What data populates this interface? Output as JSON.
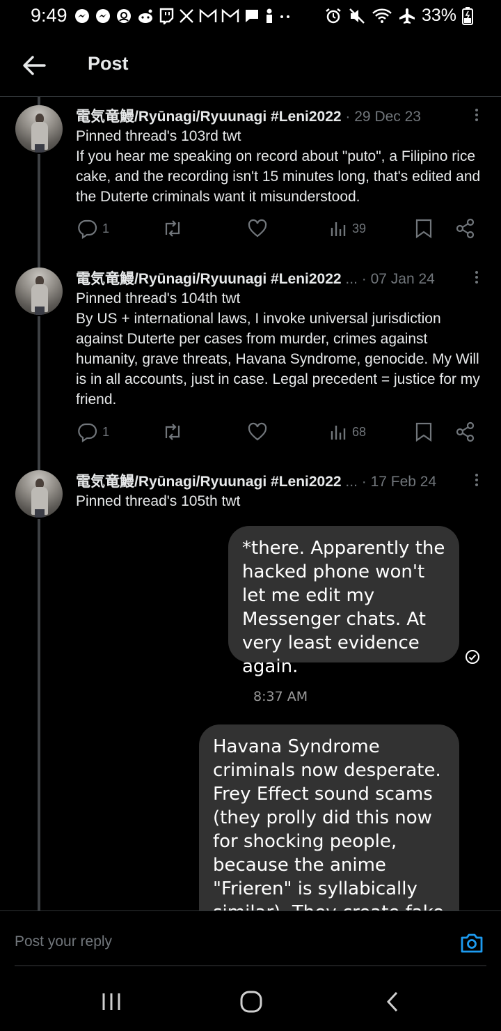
{
  "status_bar": {
    "time": "9:49",
    "battery": "33%",
    "icons_left": [
      "messenger-icon",
      "messenger-icon",
      "threads-icon",
      "reddit-icon",
      "twitch-icon",
      "x-icon",
      "gmail-icon",
      "gmail-icon",
      "chat-icon",
      "notification-icon",
      "more-dots-icon"
    ],
    "icons_right": [
      "alarm-icon",
      "mute-icon",
      "wifi-icon",
      "airplane-icon",
      "battery-icon"
    ]
  },
  "header": {
    "title": "Post"
  },
  "tweets": [
    {
      "author": "電気竜鰻/Ryūnagi/Ryuunagi #Leni2022",
      "meta": " · 29 Dec 23",
      "pinned": "Pinned thread's 103rd twt",
      "text": "If you hear me speaking on record about \"puto\", a Filipino rice cake, and the recording isn't 15 minutes long, that's edited and the Duterte criminals want it misunderstood.",
      "replies": "1",
      "views": "39"
    },
    {
      "author": "電気竜鰻/Ryūnagi/Ryuunagi #Leni2022",
      "meta": " ... · 07 Jan 24",
      "pinned": "Pinned thread's 104th twt",
      "text": "By US + international laws, I invoke universal jurisdiction against Duterte per cases from murder, crimes against humanity, grave threats, Havana Syndrome, genocide. My Will is in all accounts, just in case. Legal precedent = justice for my friend.",
      "replies": "1",
      "views": "68"
    },
    {
      "author": "電気竜鰻/Ryūnagi/Ryuunagi #Leni2022",
      "meta": " ... · 17 Feb 24",
      "pinned": "Pinned thread's 105th twt"
    }
  ],
  "chat": {
    "bubble1": "*there. Apparently the hacked phone won't let me edit my Messenger chats. At very least evidence again.",
    "time": "8:37 AM",
    "bubble2": "Havana Syndrome criminals now desperate. Frey Effect sound scams (they prolly did this now for shocking people, because the anime \"Frieren\" is syllabically similar). They create fake"
  },
  "reply": {
    "placeholder": "Post your reply"
  },
  "colors": {
    "background": "#000000",
    "text": "#e7e9ea",
    "muted": "#71767b",
    "accent": "#1d9bf0",
    "bubble": "#323232"
  }
}
